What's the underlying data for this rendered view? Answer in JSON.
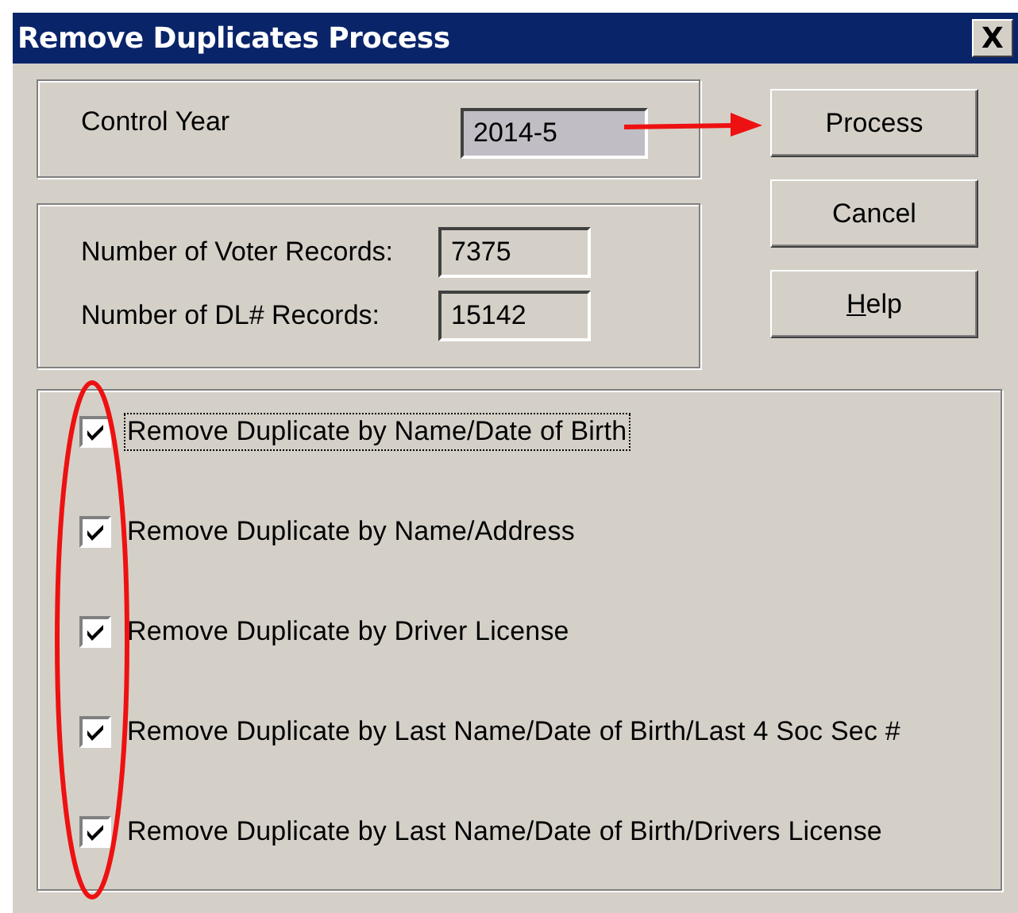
{
  "window": {
    "title": "Remove Duplicates Process",
    "close_glyph": "X"
  },
  "control_year": {
    "label": "Control Year",
    "value": "2014-5"
  },
  "records": [
    {
      "label": "Number of Voter Records:",
      "value": "7375"
    },
    {
      "label": "Number of DL# Records:",
      "value": "15142"
    }
  ],
  "buttons": [
    {
      "label": "Process",
      "mnemonic": false
    },
    {
      "label": "Cancel",
      "mnemonic": false
    },
    {
      "label": "Help",
      "mnemonic": true
    }
  ],
  "options": [
    {
      "label": "Remove Duplicate by Name/Date of Birth",
      "checked": true,
      "focused": true
    },
    {
      "label": "Remove Duplicate by Name/Address",
      "checked": true,
      "focused": false
    },
    {
      "label": "Remove Duplicate by Driver License",
      "checked": true,
      "focused": false
    },
    {
      "label": "Remove Duplicate by Last Name/Date of Birth/Last 4 Soc Sec #",
      "checked": true,
      "focused": false
    },
    {
      "label": "Remove Duplicate by Last Name/Date of Birth/Drivers License",
      "checked": true,
      "focused": false
    }
  ],
  "annotations": {
    "arrow": true,
    "ellipse": true
  }
}
